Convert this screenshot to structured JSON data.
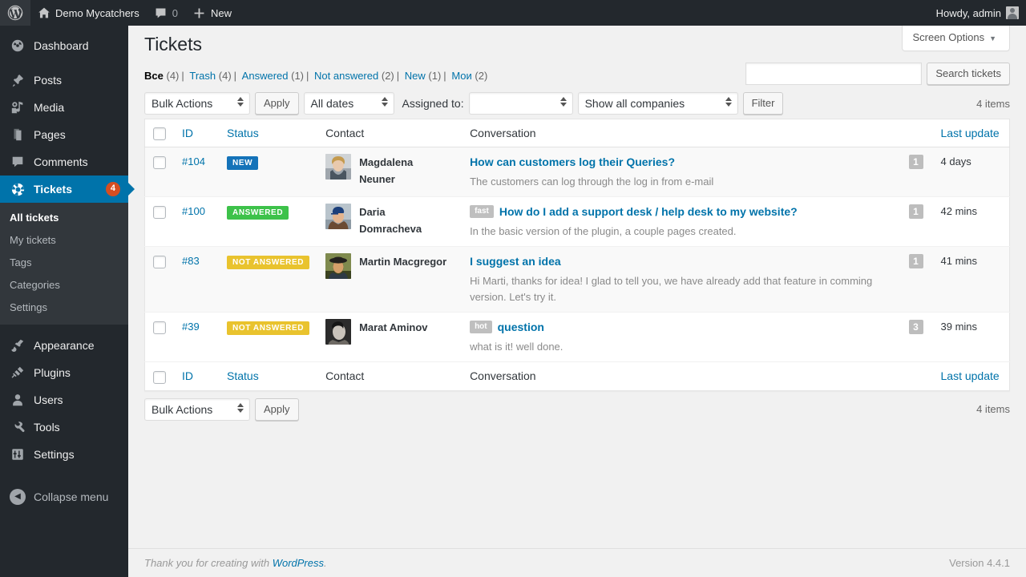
{
  "adminbar": {
    "logo_icon": "wordpress-logo-icon",
    "site_name": "Demo Mycatchers",
    "site_icon": "home-icon",
    "comments_icon": "comment-bubble-icon",
    "comments_count": "0",
    "new_icon": "plus-icon",
    "new_label": "New",
    "howdy": "Howdy, admin",
    "avatar_icon": "user-avatar-icon"
  },
  "sidebar": {
    "items": [
      {
        "label": "Dashboard",
        "icon": "dashboard-icon",
        "glyph": "◔",
        "name": "dashboard"
      },
      {
        "label": "Posts",
        "icon": "pin-icon",
        "glyph": "✒",
        "name": "posts"
      },
      {
        "label": "Media",
        "icon": "media-icon",
        "glyph": "♫",
        "name": "media"
      },
      {
        "label": "Pages",
        "icon": "page-icon",
        "glyph": "❐",
        "name": "pages"
      },
      {
        "label": "Comments",
        "icon": "comment-icon",
        "glyph": "▭",
        "name": "comments"
      },
      {
        "label": "Tickets",
        "icon": "ticket-lifebuoy-icon",
        "glyph": "☸",
        "name": "tickets",
        "badge": "4",
        "current": true
      },
      {
        "label": "Appearance",
        "icon": "brush-icon",
        "glyph": "✒",
        "name": "appearance"
      },
      {
        "label": "Plugins",
        "icon": "plug-icon",
        "glyph": "⚡",
        "name": "plugins"
      },
      {
        "label": "Users",
        "icon": "users-icon",
        "glyph": "♟",
        "name": "users"
      },
      {
        "label": "Tools",
        "icon": "wrench-icon",
        "glyph": "⚒",
        "name": "tools"
      },
      {
        "label": "Settings",
        "icon": "settings-sliders-icon",
        "glyph": "⚙",
        "name": "settings"
      }
    ],
    "submenu": [
      {
        "label": "All tickets",
        "current": true
      },
      {
        "label": "My tickets",
        "current": false
      },
      {
        "label": "Tags",
        "current": false
      },
      {
        "label": "Categories",
        "current": false
      },
      {
        "label": "Settings",
        "current": false
      }
    ],
    "collapse": {
      "label": "Collapse menu",
      "icon": "collapse-arrow-icon",
      "glyph": "◀"
    }
  },
  "screen_options": {
    "label": "Screen Options",
    "caret_icon": "chevron-down-icon"
  },
  "page": {
    "title": "Tickets"
  },
  "filters": [
    {
      "label": "Все",
      "count": "(4)",
      "current": true
    },
    {
      "label": "Trash",
      "count": "(4)",
      "current": false
    },
    {
      "label": "Answered",
      "count": "(1)",
      "current": false
    },
    {
      "label": "Not answered",
      "count": "(2)",
      "current": false
    },
    {
      "label": "New",
      "count": "(1)",
      "current": false
    },
    {
      "label": "Мои",
      "count": "(2)",
      "current": false
    }
  ],
  "search": {
    "value": "",
    "placeholder": "",
    "button_label": "Search tickets"
  },
  "tablenav_top": {
    "bulk_actions": "Bulk Actions",
    "apply_label": "Apply",
    "dates": "All dates",
    "assigned_label": "Assigned to:",
    "assigned_value": "",
    "companies": "Show all companies",
    "filter_label": "Filter",
    "items_count": "4 items"
  },
  "tablenav_bottom": {
    "bulk_actions": "Bulk Actions",
    "apply_label": "Apply",
    "items_count": "4 items"
  },
  "table": {
    "columns": {
      "id": "ID",
      "status": "Status",
      "contact": "Contact",
      "conversation": "Conversation",
      "last_update": "Last update"
    },
    "rows": [
      {
        "id": "#104",
        "status": {
          "label": "NEW",
          "kind": "new",
          "color": "#1573b9"
        },
        "contact": "Magdalena Neuner",
        "avatar_icon": "contact-avatar-magdalena",
        "tag": "",
        "title": "How can customers log their Queries?",
        "excerpt": "The customers can log through the log in from e-mail",
        "count": "1",
        "last_update": "4 days"
      },
      {
        "id": "#100",
        "status": {
          "label": "ANSWERED",
          "kind": "answered",
          "color": "#3dc24a"
        },
        "contact": "Daria Domracheva",
        "avatar_icon": "contact-avatar-daria",
        "tag": "fast",
        "title": "How do I add a support desk / help desk to my website?",
        "excerpt": "In the basic version of the plugin, a couple pages created.",
        "count": "1",
        "last_update": "42 mins"
      },
      {
        "id": "#83",
        "status": {
          "label": "NOT ANSWERED",
          "kind": "notanswered",
          "color": "#e9c32e"
        },
        "contact": "Martin Macgregor",
        "avatar_icon": "contact-avatar-martin",
        "tag": "",
        "title": "I suggest an idea",
        "excerpt": "Hi Marti, thanks for idea! I glad to tell you, we have already add that feature in comming version. Let's try it.",
        "count": "1",
        "last_update": "41 mins"
      },
      {
        "id": "#39",
        "status": {
          "label": "NOT ANSWERED",
          "kind": "notanswered",
          "color": "#e9c32e"
        },
        "contact": "Marat Aminov",
        "avatar_icon": "contact-avatar-marat",
        "tag": "hot",
        "title": "question",
        "excerpt": "what is it!  well done.",
        "count": "3",
        "last_update": "39 mins"
      }
    ]
  },
  "footer": {
    "thanks_prefix": "Thank you for creating with ",
    "wordpress_link": "WordPress",
    "thanks_suffix": ".",
    "version": "Version 4.4.1"
  }
}
